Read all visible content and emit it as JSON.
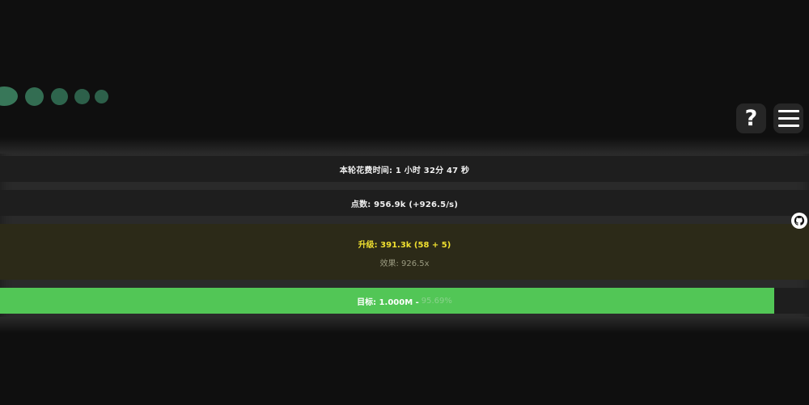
{
  "header": {
    "help_label": "?",
    "icons": {
      "help": "question-icon",
      "menu": "hamburger-menu-icon",
      "side": "github-cat-icon"
    }
  },
  "stats": {
    "time_text": "本轮花费时间: 1 小时 32分 47 秒",
    "points_text": "点数: 956.9k (+926.5/s)"
  },
  "upgrade": {
    "title": "升级: 391.3k (58 + 5)",
    "effect": "效果: 926.5x"
  },
  "goal": {
    "label": "目标: 1.000M -",
    "percent_text": "95.69%",
    "progress_fraction": 0.9569
  },
  "colors": {
    "background": "#0f0f0f",
    "goal_fill": "#52c656",
    "upgrade_title": "#f0e030",
    "dots": "#3a7a5c"
  }
}
